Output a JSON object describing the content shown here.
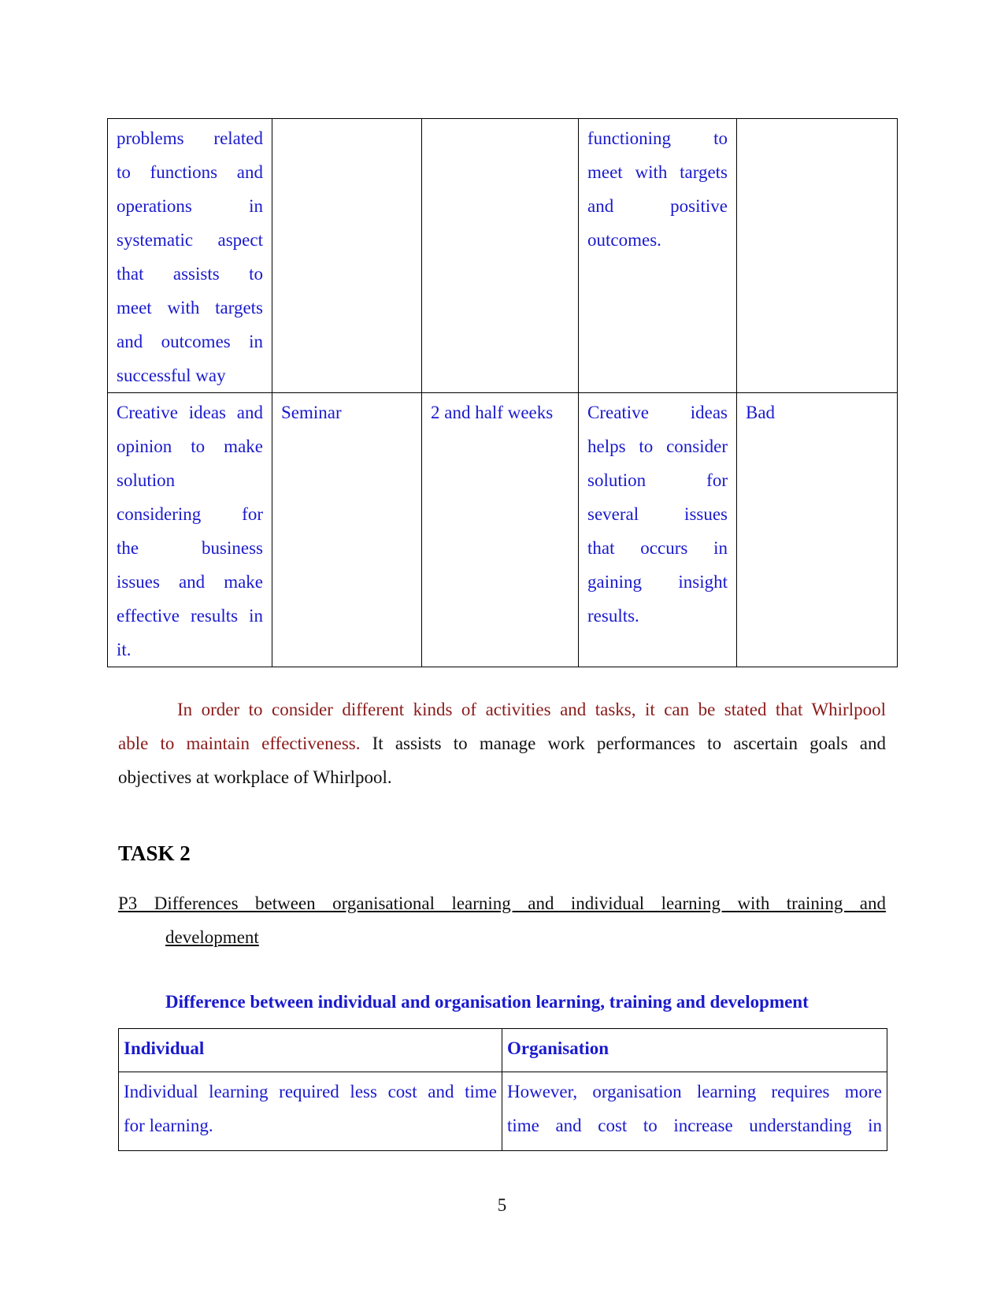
{
  "table1": {
    "row1": {
      "col1_lines": [
        "problems related",
        "to functions and",
        "operations in",
        "systematic aspect",
        "that assists to",
        "meet with targets",
        "and outcomes in"
      ],
      "col1_last": "successful way",
      "col2": "",
      "col3": "",
      "col4_lines": [
        "functioning to",
        "meet with targets",
        "and positive"
      ],
      "col4_last": "outcomes.",
      "col5": ""
    },
    "row2": {
      "col1_lines": [
        "Creative ideas and",
        "opinion to make"
      ],
      "col1_mid": "solution",
      "col1_lines2": [
        "considering for",
        "the business",
        "issues and make",
        "effective results in"
      ],
      "col1_last": "it.",
      "col2": "Seminar",
      "col3": "2 and half weeks",
      "col4_lines": [
        "Creative ideas",
        "helps to consider",
        "solution for",
        "several issues",
        "that occurs in",
        "gaining insight"
      ],
      "col4_last": "results.",
      "col5": "Bad"
    }
  },
  "paragraph": {
    "line1": "In order to consider different kinds of activities and tasks, it can be stated that Whirlpool",
    "line2_maroon": "able to maintain effectiveness.",
    "line2_black": " It assists to manage work performances to ascertain goals and",
    "line3": "objectives at workplace of Whirlpool."
  },
  "task_heading": "TASK 2",
  "subheading": {
    "line1": "P3 Differences between organisational learning and individual learning with training and",
    "line2": "development"
  },
  "table2": {
    "caption": "Difference between individual and organisation learning, training and development",
    "headers": [
      "Individual",
      "Organisation"
    ],
    "row1": {
      "individual_lines": [
        "Individual learning required less cost and time",
        "for learning."
      ],
      "organisation_lines": [
        "However, organisation learning requires more",
        "time and cost to increase understanding in"
      ]
    }
  },
  "page_number": "5"
}
